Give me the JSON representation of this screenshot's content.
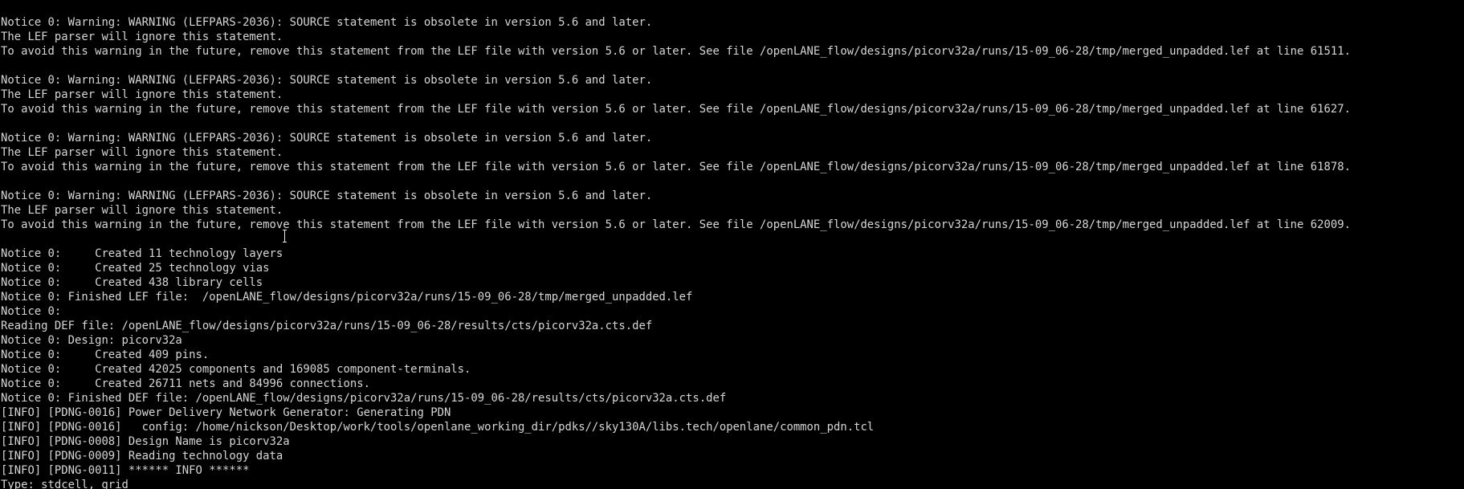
{
  "colors": {
    "background": "#000000",
    "foreground": "#d6d6d6"
  },
  "cursor_icon": "text-ibeam-icon",
  "lines": [
    "Notice 0: Warning: WARNING (LEFPARS-2036): SOURCE statement is obsolete in version 5.6 and later.",
    "The LEF parser will ignore this statement.",
    "To avoid this warning in the future, remove this statement from the LEF file with version 5.6 or later. See file /openLANE_flow/designs/picorv32a/runs/15-09_06-28/tmp/merged_unpadded.lef at line 61511.",
    "",
    "Notice 0: Warning: WARNING (LEFPARS-2036): SOURCE statement is obsolete in version 5.6 and later.",
    "The LEF parser will ignore this statement.",
    "To avoid this warning in the future, remove this statement from the LEF file with version 5.6 or later. See file /openLANE_flow/designs/picorv32a/runs/15-09_06-28/tmp/merged_unpadded.lef at line 61627.",
    "",
    "Notice 0: Warning: WARNING (LEFPARS-2036): SOURCE statement is obsolete in version 5.6 and later.",
    "The LEF parser will ignore this statement.",
    "To avoid this warning in the future, remove this statement from the LEF file with version 5.6 or later. See file /openLANE_flow/designs/picorv32a/runs/15-09_06-28/tmp/merged_unpadded.lef at line 61878.",
    "",
    "Notice 0: Warning: WARNING (LEFPARS-2036): SOURCE statement is obsolete in version 5.6 and later.",
    "The LEF parser will ignore this statement.",
    "To avoid this warning in the future, remove this statement from the LEF file with version 5.6 or later. See file /openLANE_flow/designs/picorv32a/runs/15-09_06-28/tmp/merged_unpadded.lef at line 62009.",
    "",
    "Notice 0:     Created 11 technology layers",
    "Notice 0:     Created 25 technology vias",
    "Notice 0:     Created 438 library cells",
    "Notice 0: Finished LEF file:  /openLANE_flow/designs/picorv32a/runs/15-09_06-28/tmp/merged_unpadded.lef",
    "Notice 0: ",
    "Reading DEF file: /openLANE_flow/designs/picorv32a/runs/15-09_06-28/results/cts/picorv32a.cts.def",
    "Notice 0: Design: picorv32a",
    "Notice 0:     Created 409 pins.",
    "Notice 0:     Created 42025 components and 169085 component-terminals.",
    "Notice 0:     Created 26711 nets and 84996 connections.",
    "Notice 0: Finished DEF file: /openLANE_flow/designs/picorv32a/runs/15-09_06-28/results/cts/picorv32a.cts.def",
    "[INFO] [PDNG-0016] Power Delivery Network Generator: Generating PDN",
    "[INFO] [PDNG-0016]   config: /home/nickson/Desktop/work/tools/openlane_working_dir/pdks//sky130A/libs.tech/openlane/common_pdn.tcl",
    "[INFO] [PDNG-0008] Design Name is picorv32a",
    "[INFO] [PDNG-0009] Reading technology data",
    "[INFO] [PDNG-0011] ****** INFO ******",
    "Type: stdcell, grid"
  ]
}
